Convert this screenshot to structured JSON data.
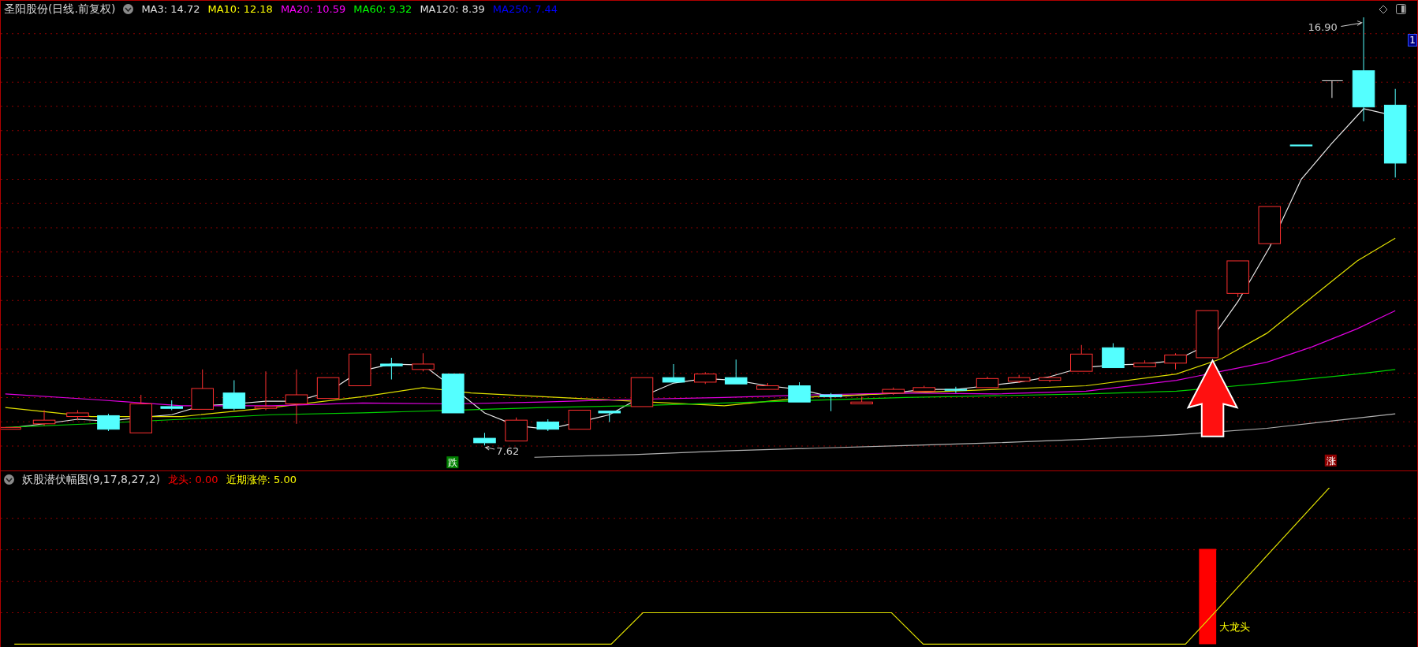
{
  "stock_header": {
    "title": "圣阳股份(日线.前复权)",
    "indicators": [
      {
        "label": "MA3: 14.72",
        "color": "#e0e0e0"
      },
      {
        "label": "MA10: 12.18",
        "color": "#ffff00"
      },
      {
        "label": "MA20: 10.59",
        "color": "#ff00ff"
      },
      {
        "label": "MA60: 9.32",
        "color": "#00ff00"
      },
      {
        "label": "MA120: 8.39",
        "color": "#e0e0e0"
      },
      {
        "label": "MA250: 7.44",
        "color": "#0000ff"
      }
    ]
  },
  "price_labels": {
    "high": "16.90",
    "low": "7.62"
  },
  "axis_label": "1",
  "markers": [
    {
      "text": "跌",
      "kind": "down"
    },
    {
      "text": "涨",
      "kind": "up"
    }
  ],
  "indicator_panel": {
    "title": "妖股潜伏幅图(9,17,8,27,2)",
    "values": [
      {
        "label": "龙头: 0.00",
        "color": "#ff0000"
      },
      {
        "label": "近期涨停: 5.00",
        "color": "#ffff00"
      }
    ],
    "signal_label": "大龙头"
  }
}
